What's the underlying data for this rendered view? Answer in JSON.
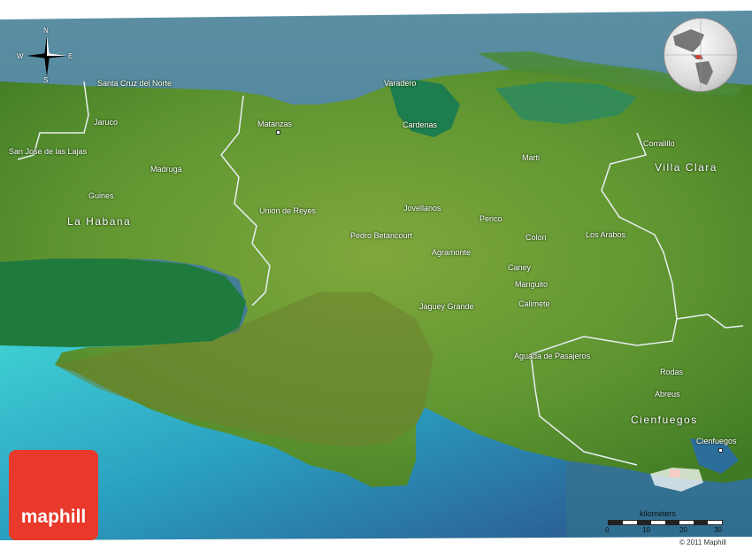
{
  "map": {
    "places": [
      {
        "name": "Santa Cruz del Norte"
      },
      {
        "name": "Varadero"
      },
      {
        "name": "Jaruco"
      },
      {
        "name": "Matanzas"
      },
      {
        "name": "Cardenas"
      },
      {
        "name": "Corralillo"
      },
      {
        "name": "San Jose de las Lajas"
      },
      {
        "name": "Marti"
      },
      {
        "name": "Madruga"
      },
      {
        "name": "Guines"
      },
      {
        "name": "Union de Reyes"
      },
      {
        "name": "Jovellanos"
      },
      {
        "name": "Perico"
      },
      {
        "name": "Pedro Betancourt"
      },
      {
        "name": "Colon"
      },
      {
        "name": "Los Arabos"
      },
      {
        "name": "Agramonte"
      },
      {
        "name": "Caney"
      },
      {
        "name": "Manguito"
      },
      {
        "name": "Jaguey Grande"
      },
      {
        "name": "Calimete"
      },
      {
        "name": "Aguada de Pasajeros"
      },
      {
        "name": "Rodas"
      },
      {
        "name": "Abreus"
      },
      {
        "name": "Cienfuegos"
      }
    ],
    "regions": [
      {
        "name": "La Habana"
      },
      {
        "name": "Villa Clara"
      },
      {
        "name": "Cienfuegos"
      }
    ],
    "compass": {
      "n": "N",
      "s": "S",
      "e": "E",
      "w": "W"
    },
    "scale": {
      "title": "kilometers",
      "ticks": [
        "0",
        "10",
        "20",
        "30"
      ]
    },
    "logo": "maphill",
    "copyright": "© 2011 Maphill"
  }
}
